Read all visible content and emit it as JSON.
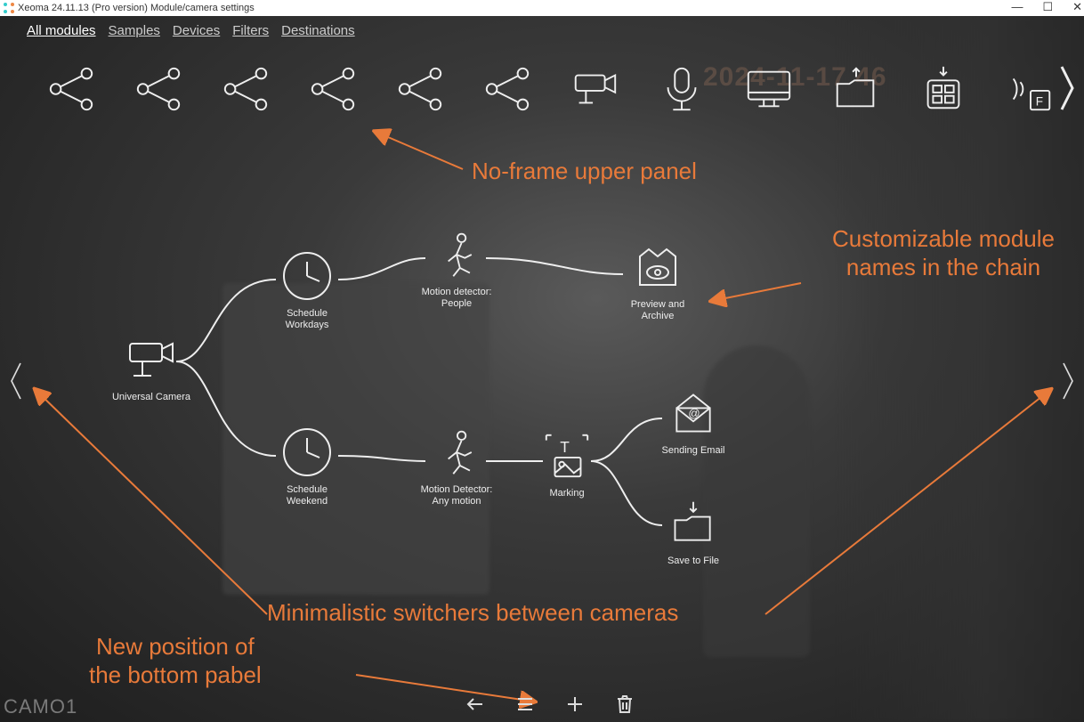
{
  "window": {
    "title": "Xeoma 24.11.13 (Pro version) Module/camera settings"
  },
  "ghost_timestamp": "2024-11-17      46",
  "tabs": {
    "all_modules": "All modules",
    "samples": "Samples",
    "devices": "Devices",
    "filters": "Filters",
    "destinations": "Destinations"
  },
  "modules": {
    "universal_camera": "Universal Camera",
    "schedule_workdays": "Schedule Workdays",
    "schedule_weekend": "Schedule Weekend",
    "motion_people": "Motion detector: People",
    "motion_any": "Motion Detector: Any motion",
    "preview_archive": "Preview and Archive",
    "marking": "Marking",
    "sending_email": "Sending Email",
    "save_to_file": "Save to File"
  },
  "annotations": {
    "upper_panel": "No-frame upper panel",
    "module_names": "Customizable module names in the chain",
    "switchers": "Minimalistic switchers between cameras",
    "bottom_panel_l1": "New position of",
    "bottom_panel_l2": "the bottom pabel"
  },
  "camera_label": "CAMO1"
}
